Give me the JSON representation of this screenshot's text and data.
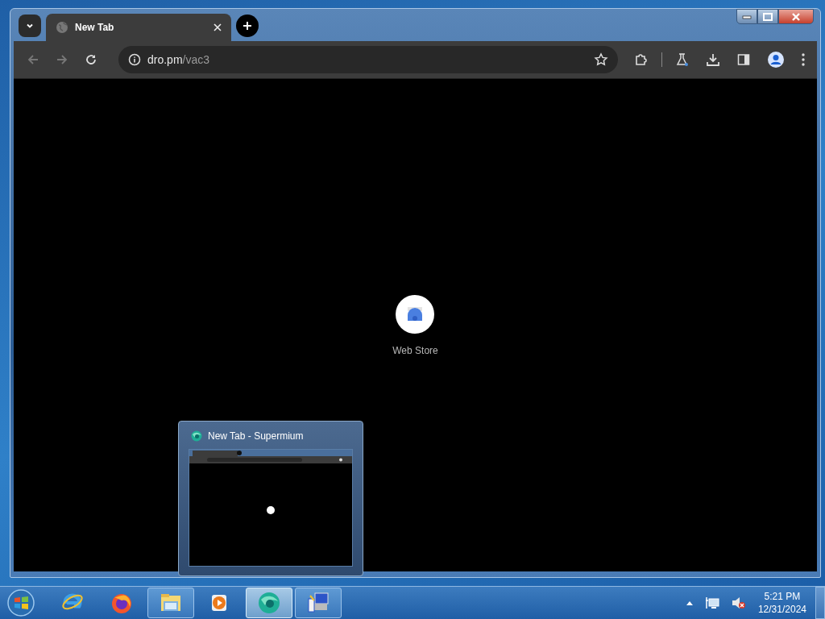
{
  "window": {
    "tabs": [
      {
        "title": "New Tab",
        "selected": true
      }
    ],
    "address": {
      "host": "dro.pm",
      "path": "/vac3"
    }
  },
  "shortcuts": [
    {
      "label": "Web Store"
    }
  ],
  "taskbar": {
    "items": [
      {
        "kind": "ie",
        "running": false,
        "selected": false
      },
      {
        "kind": "firefox",
        "running": false,
        "selected": false
      },
      {
        "kind": "explorer",
        "running": true,
        "selected": false
      },
      {
        "kind": "media",
        "running": false,
        "selected": false
      },
      {
        "kind": "browser",
        "running": true,
        "selected": true
      },
      {
        "kind": "installer",
        "running": true,
        "selected": false
      }
    ],
    "clock": {
      "time": "5:21 PM",
      "date": "12/31/2024"
    }
  },
  "preview": {
    "title": "New Tab - Supermium"
  }
}
